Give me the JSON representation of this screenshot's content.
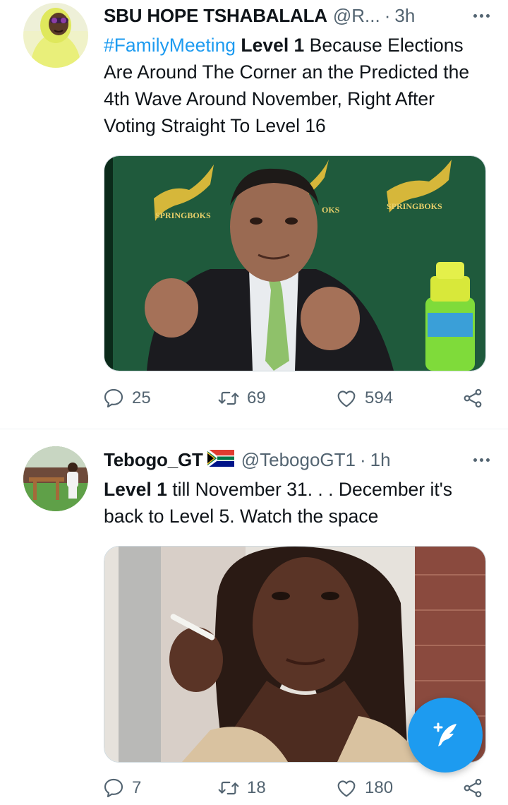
{
  "tweets": [
    {
      "name": "SBU HOPE TSHABALALA",
      "handle": "@R...",
      "separator": "·",
      "time": "3h",
      "hashtag": "#FamilyMeeting",
      "bold_text": "Level 1",
      "text": " Because Elections Are Around The Corner an the Predicted the 4th Wave Around November, Right After Voting Straight To Level 16",
      "media_image": {
        "banner_text_1": "SPRINGBOKS",
        "banner_text_2": "OKS",
        "banner_text_3": "SPRINGBOKS"
      },
      "replies": "25",
      "retweets": "69",
      "likes": "594"
    },
    {
      "name": "Tebogo_GT",
      "flag": "south-africa-flag",
      "handle": "@TebogoGT1",
      "separator": "·",
      "time": "1h",
      "bold_text": "Level 1",
      "text": " till November 31. . . December it's back to Level 5. Watch the space",
      "replies": "7",
      "retweets": "18",
      "likes": "180"
    }
  ],
  "colors": {
    "accent": "#1d9bf0",
    "secondary_text": "#536471",
    "text": "#0f1419",
    "divider": "#eff3f4"
  },
  "fab": {
    "icon": "compose-tweet-icon"
  }
}
